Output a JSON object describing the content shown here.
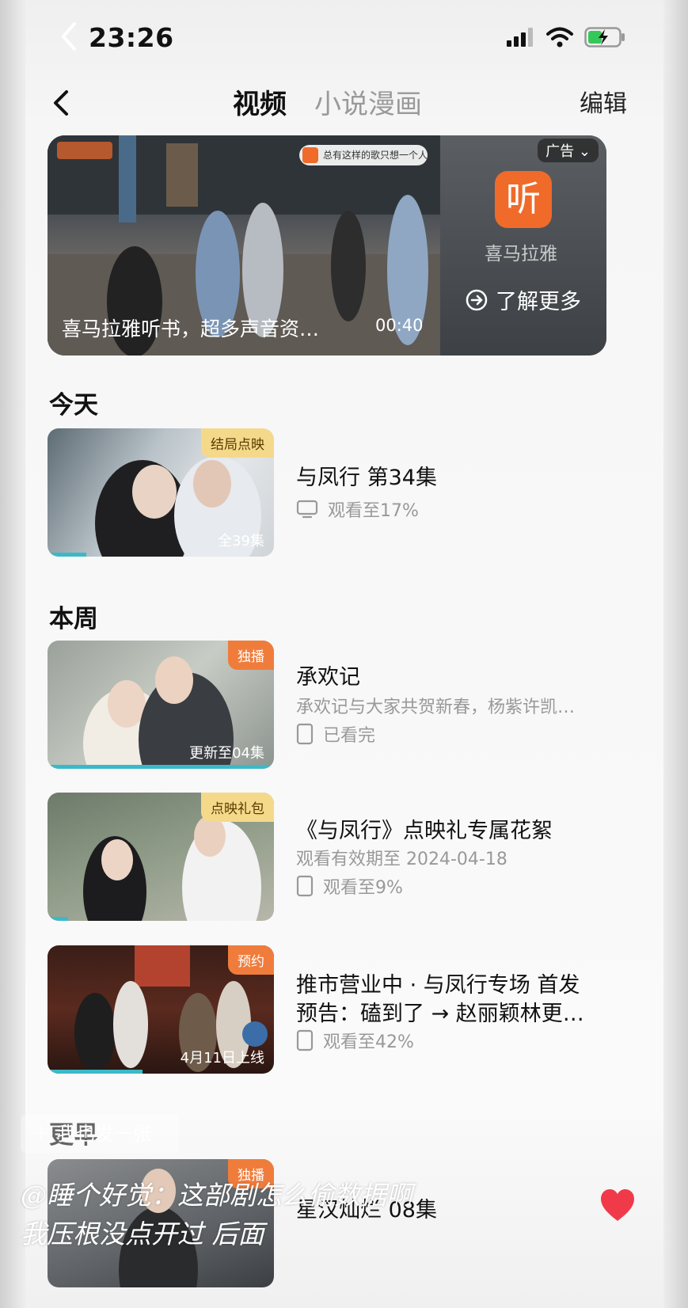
{
  "status_bar": {
    "time": "23:26"
  },
  "nav": {
    "tab_video": "视频",
    "tab_novel": "小说漫画",
    "edit": "编辑"
  },
  "ad": {
    "badge": "广告",
    "search_text": "总有这样的歌只想一个人听",
    "brand": "喜马拉雅",
    "logo_char": "听",
    "learn_more": "了解更多",
    "caption": "喜马拉雅听书，超多声音资…",
    "duration": "00:40"
  },
  "sections": {
    "today": "今天",
    "week": "本周",
    "earlier": "更早"
  },
  "items": [
    {
      "tag": "结局点映",
      "episodes": "全39集",
      "title": "与凤行 第34集",
      "status": "观看至17%",
      "progress": 0.17
    },
    {
      "tag": "独播",
      "episodes": "更新至04集",
      "title": "承欢记",
      "desc": "承欢记与大家共贺新春，杨紫许凯…",
      "status": "已看完",
      "progress": 1.0
    },
    {
      "tag": "点映礼包",
      "title": "《与凤行》点映礼专属花絮",
      "desc": "观看有效期至 2024-04-18",
      "status": "观看至9%",
      "progress": 0.09
    },
    {
      "tag": "预约",
      "episodes": "4月11日上线",
      "title_line1": "推市营业中 · 与凤行专场 首发",
      "title_line2": "预告：磕到了 → 赵丽颖林更…",
      "status": "观看至42%",
      "progress": 0.42
    },
    {
      "tag": "独播",
      "title": "星汉灿烂 08集"
    }
  ],
  "overlay": {
    "post": "我也发一张",
    "comment_line1": "@睡个好觉：这部剧怎么偷数据啊",
    "comment_line2": "我压根没点开过 后面"
  },
  "colors": {
    "accent": "#3bb9c8",
    "tag_orange": "#f07c3c",
    "tag_yellow": "#f5d98b",
    "brand_orange": "#f06a2a"
  }
}
